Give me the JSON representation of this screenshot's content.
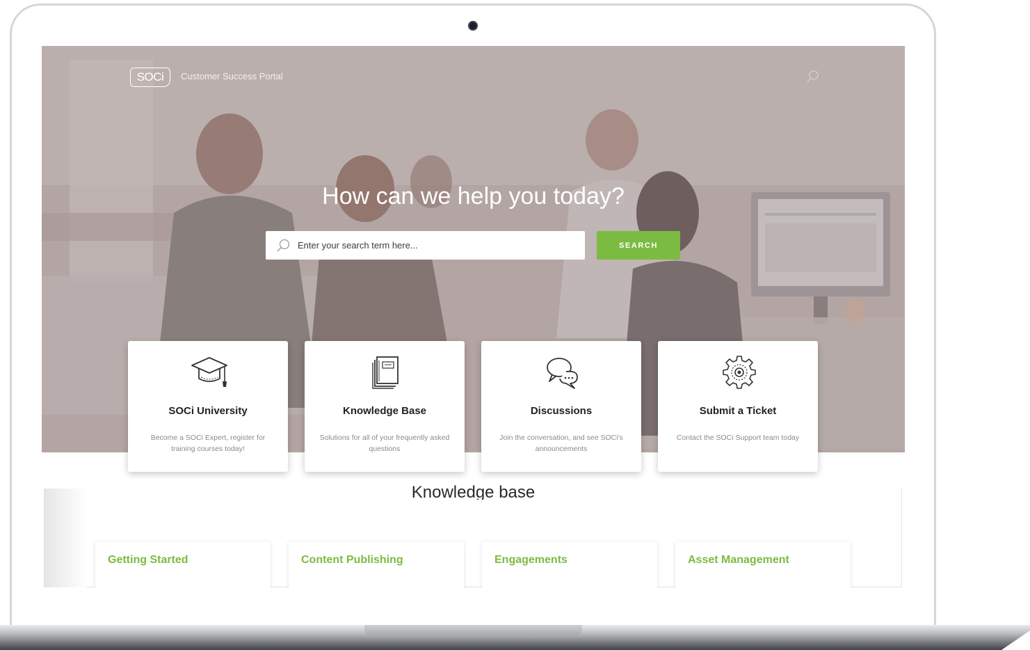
{
  "header": {
    "logo_text": "SOCi",
    "portal_title": "Customer Success Portal"
  },
  "hero": {
    "heading": "How can we help you today?",
    "search_placeholder": "Enter your search term here...",
    "search_button": "SEARCH"
  },
  "features": [
    {
      "title": "SOCi University",
      "description": "Become a SOCi Expert, register for training courses today!",
      "icon": "graduation-cap-icon"
    },
    {
      "title": "Knowledge Base",
      "description": "Solutions for all of your frequently asked questions",
      "icon": "book-icon"
    },
    {
      "title": "Discussions",
      "description": "Join the conversation, and see SOCi's announcements",
      "icon": "chat-bubbles-icon"
    },
    {
      "title": "Submit a Ticket",
      "description": "Contact the SOCi Support team today",
      "icon": "gear-icon"
    }
  ],
  "knowledge_base": {
    "heading": "Knowledge base",
    "categories": [
      "Getting Started",
      "Content Publishing",
      "Engagements",
      "Asset Management"
    ]
  },
  "colors": {
    "accent": "#7cbb42",
    "card_text": "#222222",
    "muted_text": "#8a8a8a"
  }
}
